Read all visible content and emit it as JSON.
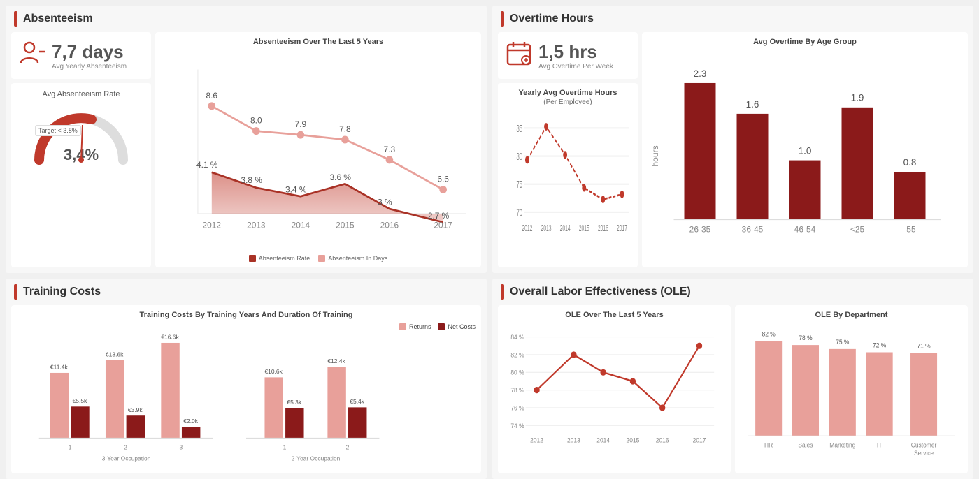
{
  "sections": {
    "absenteeism": {
      "title": "Absenteeism",
      "kpi_value": "7,7 days",
      "kpi_label": "Avg Yearly Absenteeism",
      "rate_title": "Avg Absenteeism Rate",
      "target_label": "Target < 3.8%",
      "rate_value": "3,4%",
      "chart_title": "Absenteeism Over The Last 5 Years",
      "legend_rate": "Absenteeism Rate",
      "legend_days": "Absenteeism In Days",
      "years": [
        "2012",
        "2013",
        "2014",
        "2015",
        "2016",
        "2017"
      ],
      "days_values": [
        8.6,
        8.0,
        7.9,
        7.8,
        7.3,
        6.6
      ],
      "rate_values": [
        4.1,
        3.8,
        3.4,
        3.6,
        3.0,
        2.7
      ]
    },
    "overtime": {
      "title": "Overtime Hours",
      "kpi_value": "1,5 hrs",
      "kpi_label": "Avg Overtime Per Week",
      "yearly_chart_title": "Yearly Avg Overtime Hours",
      "yearly_chart_subtitle": "(Per Employee)",
      "yearly_years": [
        "2012",
        "2013",
        "2014",
        "2015",
        "2016",
        "2017"
      ],
      "yearly_values": [
        79,
        85,
        80,
        75,
        73,
        74
      ],
      "bar_chart_title": "Avg Overtime By Age Group",
      "age_groups": [
        "26-35",
        "36-45",
        "46-54",
        "<25",
        "-55"
      ],
      "age_values": [
        2.3,
        1.6,
        1.0,
        1.9,
        0.8
      ],
      "bar_label": "hours"
    },
    "training": {
      "title": "Training Costs",
      "chart_title": "Training Costs By Training Years And Duration Of Training",
      "legend_returns": "Returns",
      "legend_net": "Net Costs",
      "three_year_label": "3-Year Occupation",
      "two_year_label": "2-Year Occupation",
      "three_groups": [
        "1",
        "2",
        "3"
      ],
      "three_returns": [
        11.4,
        13.6,
        16.6
      ],
      "three_net": [
        5.5,
        3.9,
        2.0
      ],
      "two_groups": [
        "1",
        "2"
      ],
      "two_returns": [
        10.6,
        12.4
      ],
      "two_net": [
        5.3,
        5.4
      ]
    },
    "ole": {
      "title": "Overall Labor Effectiveness (OLE)",
      "line_chart_title": "OLE Over The Last 5 Years",
      "bar_chart_title": "OLE By Department",
      "years": [
        "2012",
        "2013",
        "2014",
        "2015",
        "2016",
        "2017"
      ],
      "ole_values": [
        78,
        82,
        80,
        79,
        76,
        83
      ],
      "departments": [
        "HR",
        "Sales",
        "Marketing",
        "IT",
        "Customer\nService"
      ],
      "dept_values": [
        82,
        78,
        75,
        72,
        71
      ],
      "dept_labels": [
        "82 %",
        "78 %",
        "75 %",
        "72 %",
        "71 %"
      ]
    }
  }
}
